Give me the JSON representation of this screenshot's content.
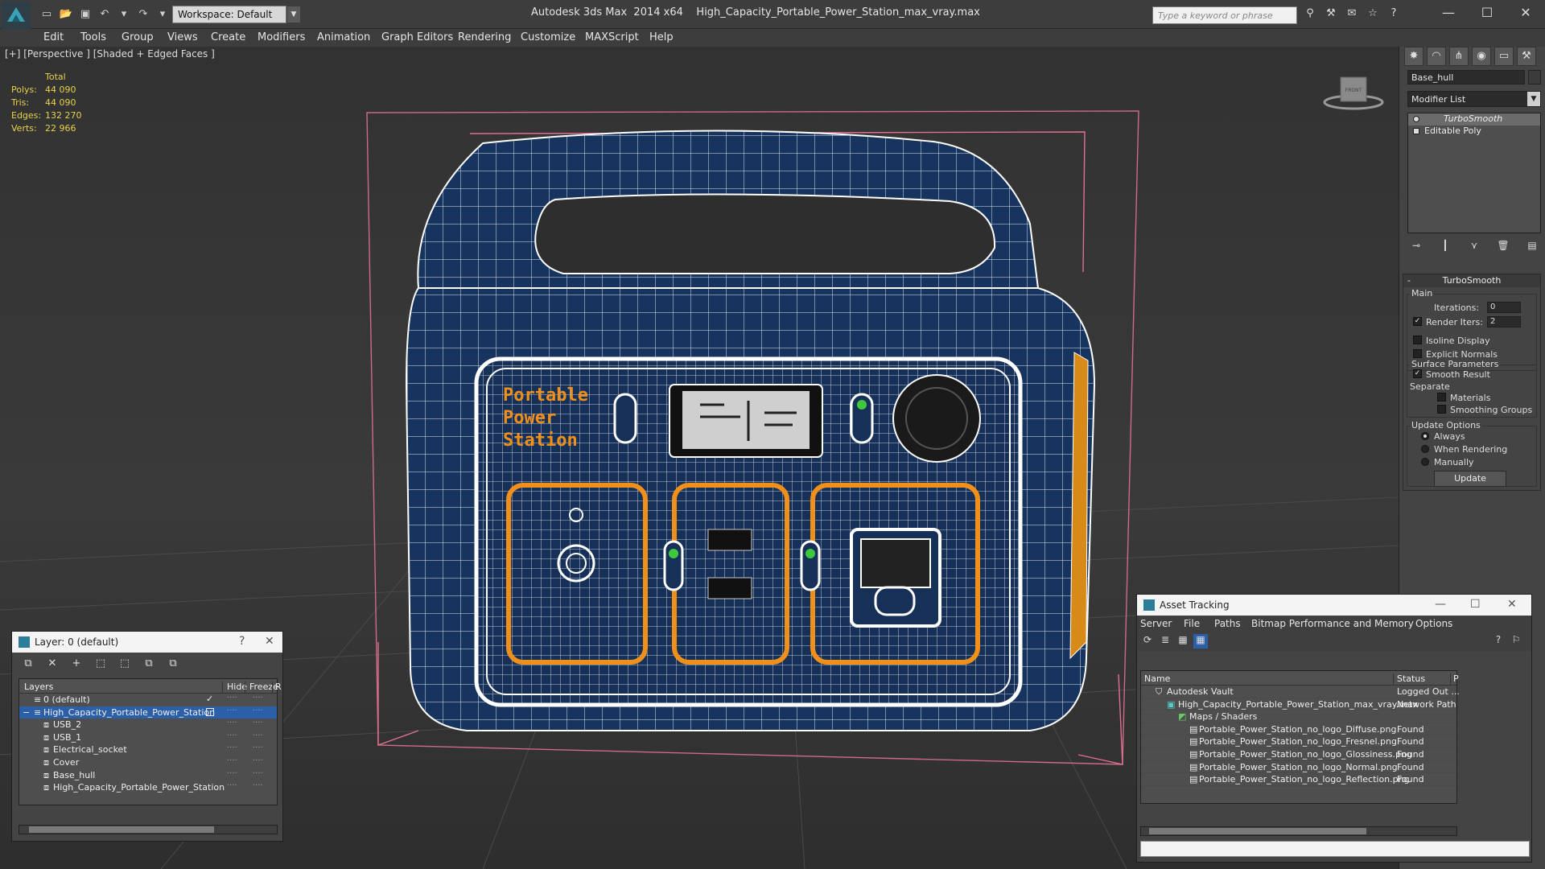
{
  "app": {
    "title": "Autodesk 3ds Max  2014 x64    High_Capacity_Portable_Power_Station_max_vray.max",
    "workspace": "Workspace: Default",
    "search_placeholder": "Type a keyword or phrase"
  },
  "menu": [
    "Edit",
    "Tools",
    "Group",
    "Views",
    "Create",
    "Modifiers",
    "Animation",
    "Graph Editors",
    "Rendering",
    "Customize",
    "MAXScript",
    "Help"
  ],
  "viewport": {
    "label": "[+] [Perspective ] [Shaded + Edged Faces ]",
    "stats_header": "Total",
    "stats": [
      {
        "key": "Polys:",
        "value": "44 090"
      },
      {
        "key": "Tris:",
        "value": "44 090"
      },
      {
        "key": "Edges:",
        "value": "132 270"
      },
      {
        "key": "Verts:",
        "value": "22 966"
      }
    ],
    "viewcube_label": "FRONT",
    "model_text": [
      "Portable",
      "Power",
      "Station"
    ]
  },
  "command_panel": {
    "object_name": "Base_hull",
    "modifier_list": "Modifier List",
    "stack": [
      "TurboSmooth",
      "Editable Poly"
    ],
    "rollout_title": "TurboSmooth",
    "main_label": "Main",
    "iterations_label": "Iterations:",
    "iterations_value": "0",
    "render_iters_label": "Render Iters:",
    "render_iters_value": "2",
    "render_iters_checked": true,
    "isoline_label": "Isoline Display",
    "explicit_label": "Explicit Normals",
    "surface_label": "Surface Parameters",
    "smooth_label": "Smooth Result",
    "smooth_checked": true,
    "separate_label": "Separate",
    "materials_label": "Materials",
    "smoothing_groups_label": "Smoothing Groups",
    "update_options_label": "Update Options",
    "always_label": "Always",
    "when_rendering_label": "When Rendering",
    "manually_label": "Manually",
    "update_button": "Update"
  },
  "layer_manager": {
    "title": "Layer: 0 (default)",
    "help": "?",
    "columns": {
      "layers": "Layers",
      "hide": "Hide",
      "freeze": "Freeze",
      "r": "R"
    },
    "rows": [
      {
        "name": "0 (default)",
        "indent": 0,
        "selected": false,
        "active": true
      },
      {
        "name": "High_Capacity_Portable_Power_Station",
        "indent": 0,
        "selected": true,
        "active": false
      },
      {
        "name": "USB_2",
        "indent": 1,
        "selected": false,
        "active": false
      },
      {
        "name": "USB_1",
        "indent": 1,
        "selected": false,
        "active": false
      },
      {
        "name": "Electrical_socket",
        "indent": 1,
        "selected": false,
        "active": false
      },
      {
        "name": "Cover",
        "indent": 1,
        "selected": false,
        "active": false
      },
      {
        "name": "Base_hull",
        "indent": 1,
        "selected": false,
        "active": false
      },
      {
        "name": "High_Capacity_Portable_Power_Station",
        "indent": 1,
        "selected": false,
        "active": false
      }
    ]
  },
  "asset_tracking": {
    "title": "Asset Tracking",
    "menu": [
      "Server",
      "File",
      "Paths",
      "Bitmap Performance and Memory",
      "Options"
    ],
    "columns": {
      "name": "Name",
      "status": "Status",
      "p": "P"
    },
    "rows": [
      {
        "name": "Autodesk Vault",
        "indent": 1,
        "status": "Logged Out ..."
      },
      {
        "name": "High_Capacity_Portable_Power_Station_max_vray.max",
        "indent": 2,
        "status": "Network Path"
      },
      {
        "name": "Maps / Shaders",
        "indent": 3,
        "status": ""
      },
      {
        "name": "Portable_Power_Station_no_logo_Diffuse.png",
        "indent": 4,
        "status": "Found"
      },
      {
        "name": "Portable_Power_Station_no_logo_Fresnel.png",
        "indent": 4,
        "status": "Found"
      },
      {
        "name": "Portable_Power_Station_no_logo_Glossiness.png",
        "indent": 4,
        "status": "Found"
      },
      {
        "name": "Portable_Power_Station_no_logo_Normal.png",
        "indent": 4,
        "status": "Found"
      },
      {
        "name": "Portable_Power_Station_no_logo_Reflection.png",
        "indent": 4,
        "status": "Found"
      }
    ]
  },
  "colors": {
    "accent_blue": "#2b5fa8",
    "stats_yellow": "#e8d24a",
    "model_blue": "#17345f",
    "model_orange": "#f0901a"
  }
}
